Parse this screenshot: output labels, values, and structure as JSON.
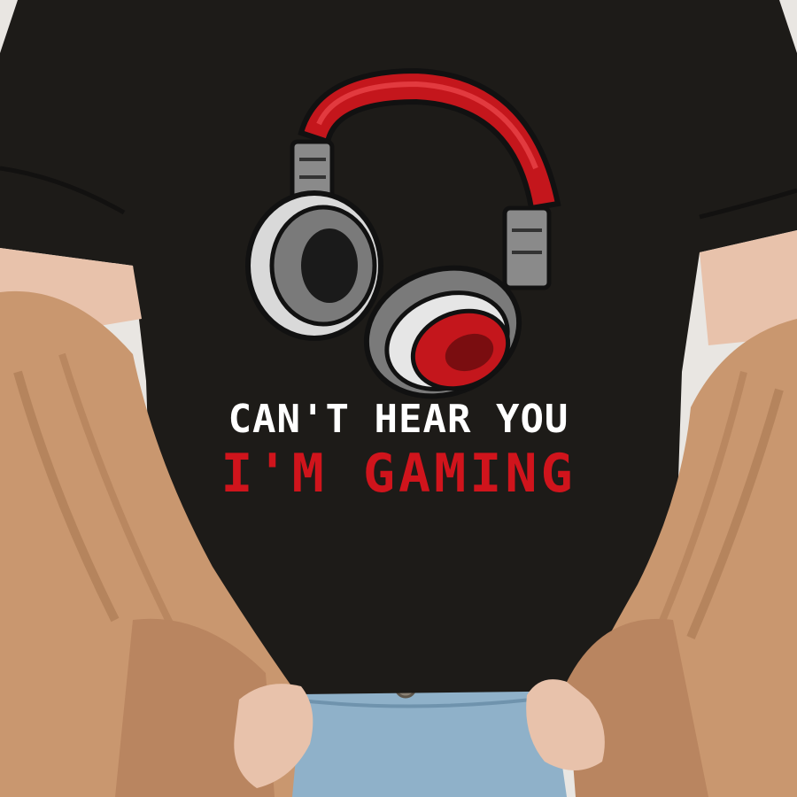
{
  "print": {
    "line1": "CAN'T HEAR YOU",
    "line2": "I'M GAMING"
  },
  "colors": {
    "background": "#e9e6e2",
    "shirt": "#1d1b18",
    "cardigan": "#c9976f",
    "cardigan_shadow": "#a97851",
    "skin": "#e8c2ab",
    "jeans": "#8fb1c9",
    "headphone_red": "#c4161c",
    "headphone_grey": "#8a8a8a",
    "text_white": "#ffffff",
    "text_red": "#d0141c"
  },
  "icons": {
    "headphones": "headphones-icon"
  }
}
